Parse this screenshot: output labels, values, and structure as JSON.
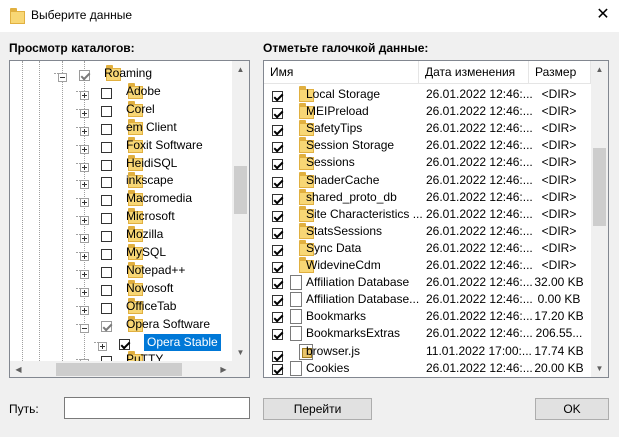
{
  "window": {
    "title": "Выберите данные",
    "close": "✕"
  },
  "left": {
    "label": "Просмотр каталогов:"
  },
  "right": {
    "label": "Отметьте галочкой данные:"
  },
  "tree": {
    "items": [
      {
        "label": "Roaming",
        "expander": "minus",
        "checked": true,
        "grey": true,
        "indent": 0
      },
      {
        "label": "Adobe",
        "expander": "plus",
        "checked": false,
        "indent": 1
      },
      {
        "label": "Corel",
        "expander": "plus",
        "checked": false,
        "indent": 1
      },
      {
        "label": "em Client",
        "expander": "plus",
        "checked": false,
        "indent": 1
      },
      {
        "label": "Foxit Software",
        "expander": "plus",
        "checked": false,
        "indent": 1
      },
      {
        "label": "HeidiSQL",
        "expander": "plus",
        "checked": false,
        "indent": 1
      },
      {
        "label": "inkscape",
        "expander": "plus",
        "checked": false,
        "indent": 1
      },
      {
        "label": "Macromedia",
        "expander": "plus",
        "checked": false,
        "indent": 1
      },
      {
        "label": "Microsoft",
        "expander": "plus",
        "checked": false,
        "indent": 1
      },
      {
        "label": "Mozilla",
        "expander": "plus",
        "checked": false,
        "indent": 1
      },
      {
        "label": "MySQL",
        "expander": "plus",
        "checked": false,
        "indent": 1
      },
      {
        "label": "Notepad++",
        "expander": "plus",
        "checked": false,
        "indent": 1
      },
      {
        "label": "Novosoft",
        "expander": "plus",
        "checked": false,
        "indent": 1
      },
      {
        "label": "OfficeTab",
        "expander": "plus",
        "checked": false,
        "indent": 1
      },
      {
        "label": "Opera Software",
        "expander": "minus",
        "checked": true,
        "grey": true,
        "indent": 1
      },
      {
        "label": "Opera Stable",
        "expander": "plus",
        "checked": true,
        "indent": 2,
        "selected": true
      },
      {
        "label": "PuTTY",
        "expander": "plus",
        "checked": false,
        "indent": 1
      }
    ]
  },
  "list": {
    "columns": [
      "Имя",
      "Дата изменения",
      "Размер"
    ],
    "rows": [
      {
        "name": "Local Storage",
        "date": "26.01.2022 12:46:...",
        "size": "<DIR>",
        "type": "folder"
      },
      {
        "name": "MEIPreload",
        "date": "26.01.2022 12:46:...",
        "size": "<DIR>",
        "type": "folder"
      },
      {
        "name": "SafetyTips",
        "date": "26.01.2022 12:46:...",
        "size": "<DIR>",
        "type": "folder"
      },
      {
        "name": "Session Storage",
        "date": "26.01.2022 12:46:...",
        "size": "<DIR>",
        "type": "folder"
      },
      {
        "name": "Sessions",
        "date": "26.01.2022 12:46:...",
        "size": "<DIR>",
        "type": "folder"
      },
      {
        "name": "ShaderCache",
        "date": "26.01.2022 12:46:...",
        "size": "<DIR>",
        "type": "folder"
      },
      {
        "name": "shared_proto_db",
        "date": "26.01.2022 12:46:...",
        "size": "<DIR>",
        "type": "folder"
      },
      {
        "name": "Site Characteristics ...",
        "date": "26.01.2022 12:46:...",
        "size": "<DIR>",
        "type": "folder"
      },
      {
        "name": "StatsSessions",
        "date": "26.01.2022 12:46:...",
        "size": "<DIR>",
        "type": "folder"
      },
      {
        "name": "Sync Data",
        "date": "26.01.2022 12:46:...",
        "size": "<DIR>",
        "type": "folder"
      },
      {
        "name": "WidevineCdm",
        "date": "26.01.2022 12:46:...",
        "size": "<DIR>",
        "type": "folder"
      },
      {
        "name": "Affiliation Database",
        "date": "26.01.2022 12:46:...",
        "size": "32.00 KB",
        "type": "file"
      },
      {
        "name": "Affiliation Database...",
        "date": "26.01.2022 12:46:...",
        "size": "0.00 KB",
        "type": "file"
      },
      {
        "name": "Bookmarks",
        "date": "26.01.2022 12:46:...",
        "size": "17.20 KB",
        "type": "file"
      },
      {
        "name": "BookmarksExtras",
        "date": "26.01.2022 12:46:...",
        "size": "206.55...",
        "type": "file"
      },
      {
        "name": "browser.js",
        "date": "11.01.2022 17:00:...",
        "size": "17.74 KB",
        "type": "js"
      },
      {
        "name": "Cookies",
        "date": "26.01.2022 12:46:...",
        "size": "20.00 KB",
        "type": "file"
      }
    ]
  },
  "path": {
    "label": "Путь:",
    "value": ""
  },
  "buttons": {
    "go": "Перейти",
    "ok": "OK"
  },
  "scroll": {
    "up": "▲",
    "down": "▼",
    "left": "◀",
    "right": "▶"
  }
}
